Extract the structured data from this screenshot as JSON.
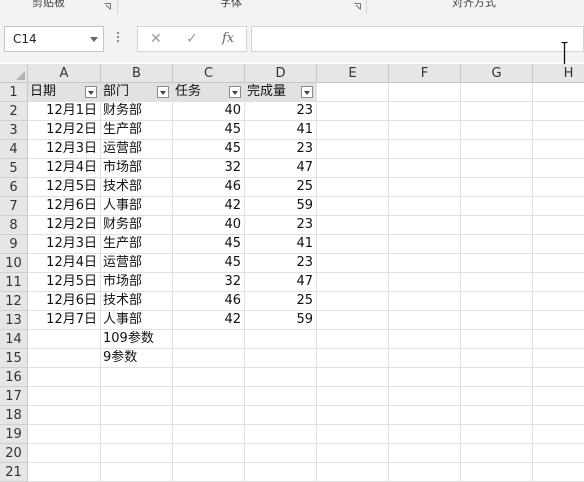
{
  "ribbon": {
    "groups": [
      {
        "label": "剪贴板"
      },
      {
        "label": "字体"
      },
      {
        "label": "对齐方式"
      }
    ]
  },
  "formula_bar": {
    "name_box": "C14",
    "cancel_icon": "✕",
    "enter_icon": "✓",
    "fx_label": "fx",
    "formula_value": ""
  },
  "sheet": {
    "columns": [
      "A",
      "B",
      "C",
      "D",
      "E",
      "F",
      "G",
      "H"
    ],
    "rows": [
      "1",
      "2",
      "3",
      "4",
      "5",
      "6",
      "7",
      "8",
      "9",
      "10",
      "11",
      "12",
      "13",
      "14",
      "15",
      "16",
      "17",
      "18",
      "19",
      "20",
      "21"
    ],
    "header_row": [
      "日期",
      "部门",
      "任务",
      "完成量"
    ],
    "data_rows": [
      [
        "12月1日",
        "财务部",
        "40",
        "23"
      ],
      [
        "12月2日",
        "生产部",
        "45",
        "41"
      ],
      [
        "12月3日",
        "运营部",
        "45",
        "23"
      ],
      [
        "12月4日",
        "市场部",
        "32",
        "47"
      ],
      [
        "12月5日",
        "技术部",
        "46",
        "25"
      ],
      [
        "12月6日",
        "人事部",
        "42",
        "59"
      ],
      [
        "12月2日",
        "财务部",
        "40",
        "23"
      ],
      [
        "12月3日",
        "生产部",
        "45",
        "41"
      ],
      [
        "12月4日",
        "运营部",
        "45",
        "23"
      ],
      [
        "12月5日",
        "市场部",
        "32",
        "47"
      ],
      [
        "12月6日",
        "技术部",
        "46",
        "25"
      ],
      [
        "12月7日",
        "人事部",
        "42",
        "59"
      ]
    ],
    "b14": "109参数",
    "b15": "9参数"
  }
}
